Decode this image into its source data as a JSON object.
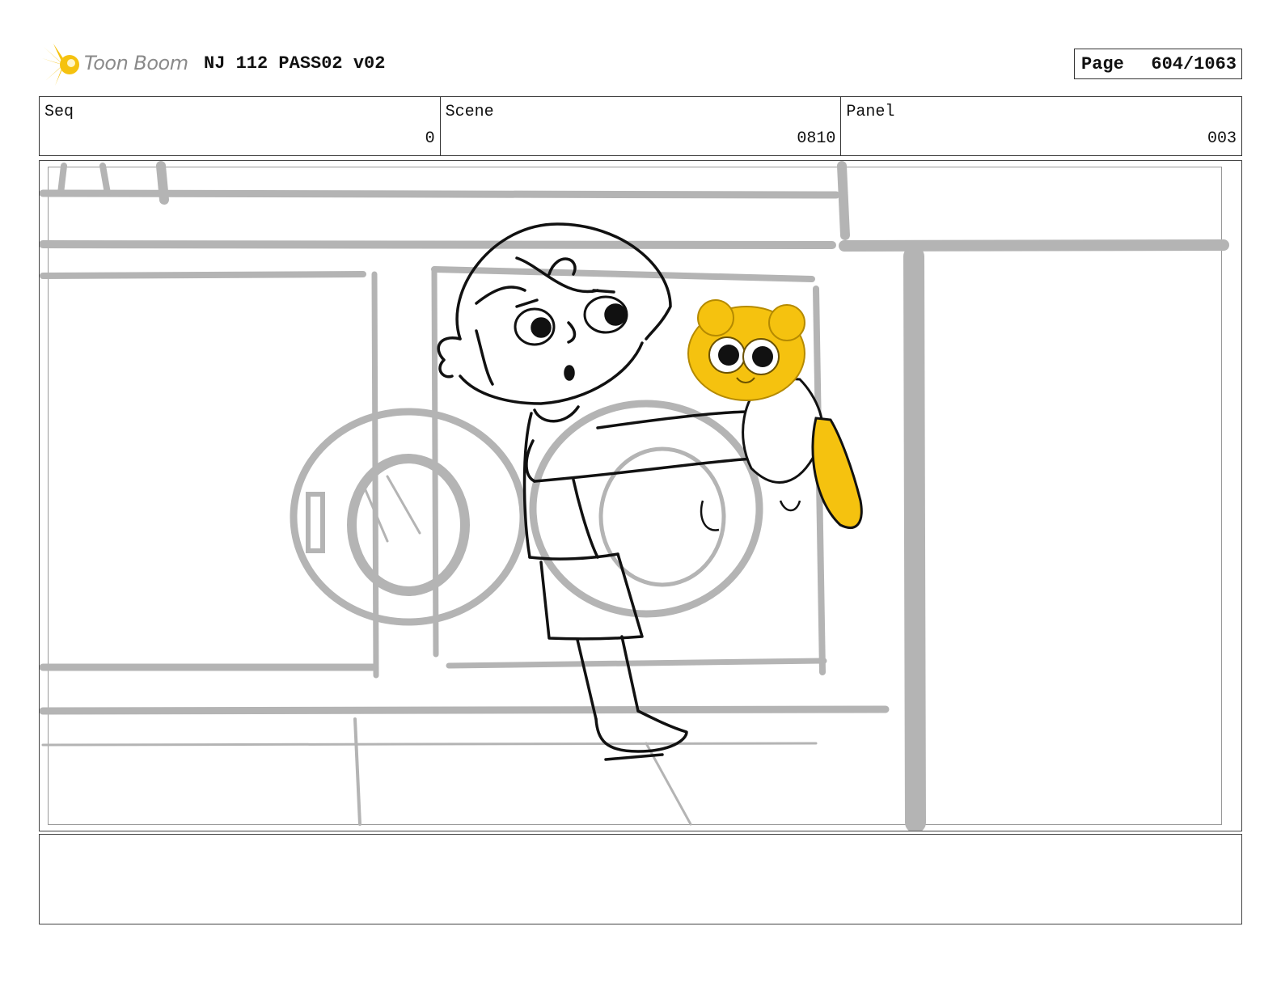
{
  "header": {
    "logo_text": "Toon Boom",
    "project_title": "NJ 112 PASS02 v02",
    "page_label": "Page",
    "page_number": "604/1063"
  },
  "info": {
    "seq_label": "Seq",
    "seq_value": "0",
    "scene_label": "Scene",
    "scene_value": "0810",
    "panel_label": "Panel",
    "panel_value": "003"
  },
  "colors": {
    "accent_yellow": "#f5c20f",
    "sketch_gray": "#b4b4b4",
    "ink": "#111111"
  },
  "notes": {
    "text": ""
  }
}
